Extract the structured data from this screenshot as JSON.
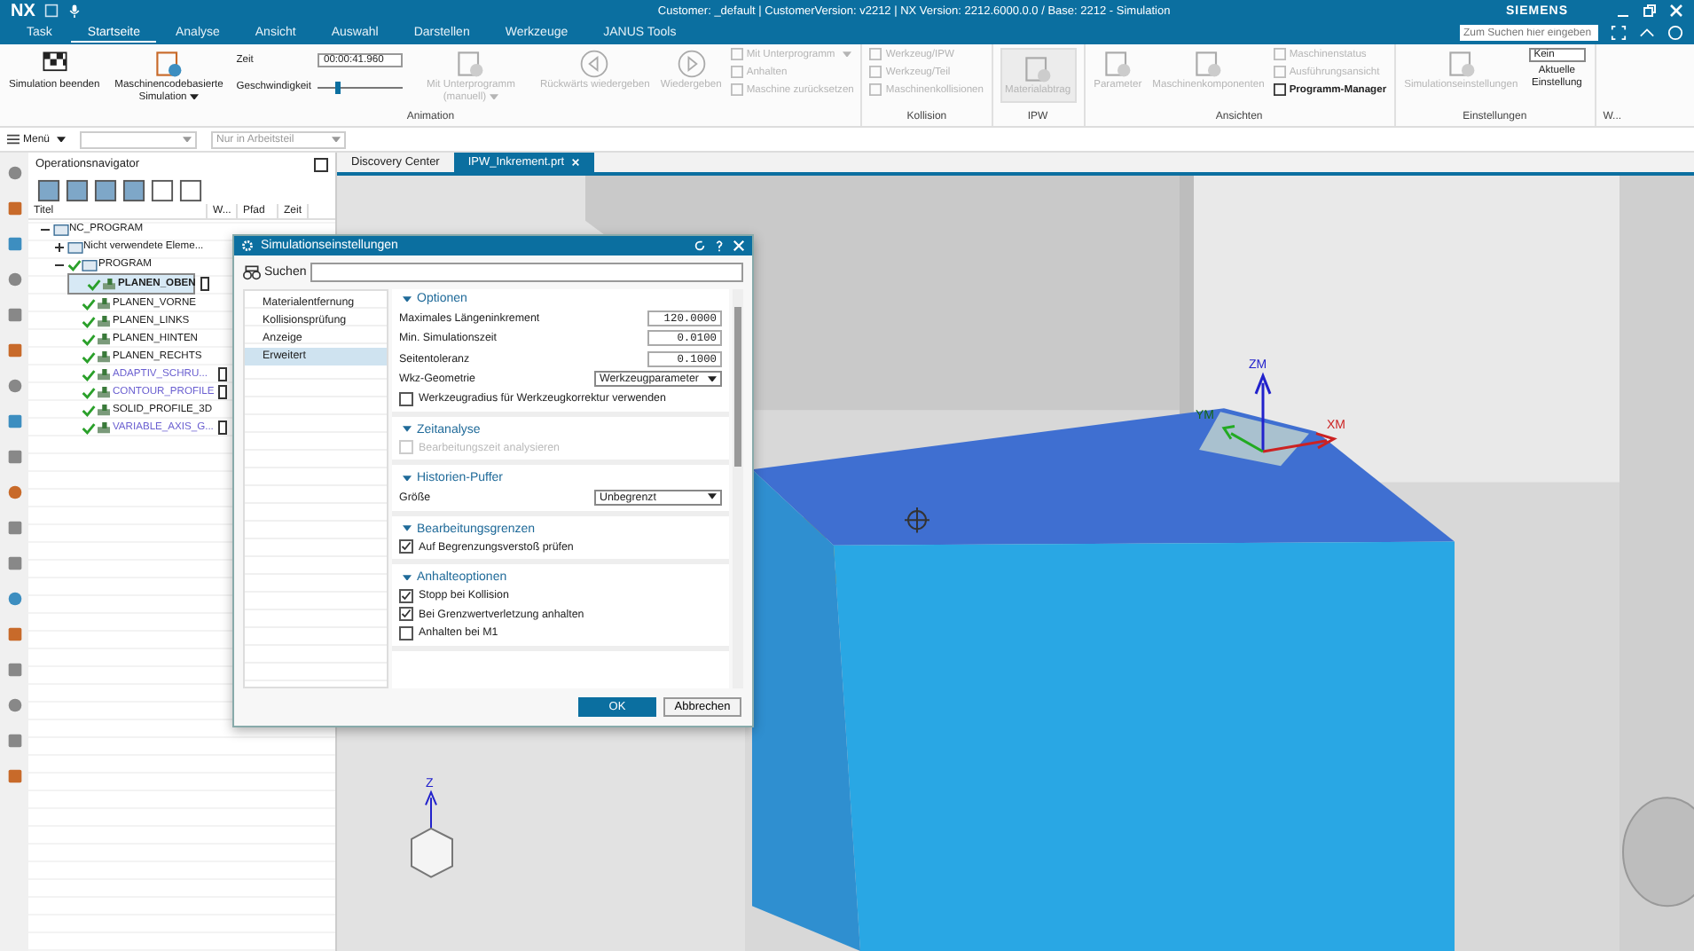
{
  "app": {
    "name": "NX",
    "title": "Customer: _default | CustomerVersion: v2212 | NX Version: 2212.6000.0.0 / Base: 2212 - Simulation",
    "brand": "SIEMENS",
    "search_placeholder": "Zum Suchen hier eingeben"
  },
  "tabs": [
    {
      "label": "Task",
      "selected": false
    },
    {
      "label": "Startseite",
      "selected": true
    },
    {
      "label": "Analyse",
      "selected": false
    },
    {
      "label": "Ansicht",
      "selected": false
    },
    {
      "label": "Auswahl",
      "selected": false
    },
    {
      "label": "Darstellen",
      "selected": false
    },
    {
      "label": "Werkzeuge",
      "selected": false
    },
    {
      "label": "JANUS Tools",
      "selected": false
    }
  ],
  "ribbon": [
    {
      "label": "Animation",
      "items": [
        {
          "kind": "big",
          "label": "Simulation beenden",
          "disabled": false,
          "dropdown": false
        },
        {
          "kind": "big",
          "label": "Maschinencodebasierte Simulation",
          "disabled": false,
          "dropdown": true
        },
        {
          "kind": "timer",
          "time_label": "Zeit",
          "time": "00:00:41.960",
          "speed_label": "Geschwindigkeit",
          "level": 0.25
        },
        {
          "kind": "big",
          "label": "Mit Unterprogramm (manuell)",
          "disabled": true,
          "dropdown": true
        },
        {
          "kind": "big",
          "label": "Rückwärts wiedergeben",
          "disabled": true,
          "dropdown": false
        },
        {
          "kind": "big",
          "label": "Wiedergeben",
          "disabled": true,
          "dropdown": false
        },
        {
          "kind": "stack",
          "entries": [
            {
              "label": "Mit Unterprogramm",
              "disabled": true,
              "dropdown": true
            },
            {
              "label": "Anhalten",
              "disabled": true,
              "dropdown": false
            },
            {
              "label": "Maschine zurücksetzen",
              "disabled": true,
              "dropdown": false
            }
          ]
        }
      ]
    },
    {
      "label": "Kollision",
      "items": [
        {
          "kind": "stack",
          "entries": [
            {
              "label": "Werkzeug/IPW",
              "disabled": true,
              "dropdown": false
            },
            {
              "label": "Werkzeug/Teil",
              "disabled": true,
              "dropdown": false
            },
            {
              "label": "Maschinenkollisionen",
              "disabled": true,
              "dropdown": false
            }
          ]
        }
      ]
    },
    {
      "label": "IPW",
      "items": [
        {
          "kind": "big",
          "label": "Materialabtrag",
          "disabled": true,
          "dropdown": false
        }
      ]
    },
    {
      "label": "Ansichten",
      "items": [
        {
          "kind": "big",
          "label": "Parameter",
          "disabled": true,
          "dropdown": false
        },
        {
          "kind": "big",
          "label": "Maschinenkomponenten",
          "disabled": true,
          "dropdown": false
        },
        {
          "kind": "stack",
          "entries": [
            {
              "label": "Maschinenstatus",
              "disabled": true,
              "dropdown": false
            },
            {
              "label": "Ausführungsansicht",
              "disabled": true,
              "dropdown": false
            },
            {
              "label": "Programm-Manager",
              "disabled": false,
              "dropdown": false
            }
          ]
        }
      ]
    },
    {
      "label": "Einstellungen",
      "items": [
        {
          "kind": "big",
          "label": "Simulationseinstellungen",
          "disabled": true,
          "dropdown": false
        },
        {
          "kind": "field",
          "value": "Kein",
          "label": "Aktuelle Einstellung"
        }
      ]
    },
    {
      "label": "W..."
    }
  ],
  "toolbar": {
    "menu": "Menü",
    "filter": "Nur in Arbeitsteil"
  },
  "navigator": {
    "title": "Operationsnavigator",
    "columns": [
      "Titel",
      "W...",
      "Pfad",
      "Zeit"
    ],
    "tree": [
      {
        "label": "NC_PROGRAM",
        "kind": "group",
        "expanded": true,
        "children": [
          {
            "label": "Nicht verwendete Eleme...",
            "kind": "group",
            "expanded": false
          },
          {
            "label": "PROGRAM",
            "kind": "group",
            "expanded": true,
            "done": true,
            "children": [
              {
                "label": "PLANEN_OBEN",
                "kind": "operation",
                "done": true,
                "selected": true,
                "color": "#1a1a1a",
                "flag": true
              },
              {
                "label": "PLANEN_VORNE",
                "kind": "operation",
                "done": true,
                "selected": false,
                "color": "#1a1a1a",
                "flag": false
              },
              {
                "label": "PLANEN_LINKS",
                "kind": "operation",
                "done": true,
                "selected": false,
                "color": "#1a1a1a",
                "flag": false
              },
              {
                "label": "PLANEN_HINTEN",
                "kind": "operation",
                "done": true,
                "selected": false,
                "color": "#1a1a1a",
                "flag": false
              },
              {
                "label": "PLANEN_RECHTS",
                "kind": "operation",
                "done": true,
                "selected": false,
                "color": "#1a1a1a",
                "flag": false
              },
              {
                "label": "ADAPTIV_SCHRU...",
                "kind": "operation",
                "done": true,
                "selected": false,
                "color": "#6a5fd0",
                "flag": true
              },
              {
                "label": "CONTOUR_PROFILE",
                "kind": "operation",
                "done": true,
                "selected": false,
                "color": "#6a5fd0",
                "flag": true
              },
              {
                "label": "SOLID_PROFILE_3D",
                "kind": "operation",
                "done": true,
                "selected": false,
                "color": "#1a1a1a",
                "flag": false
              },
              {
                "label": "VARIABLE_AXIS_G...",
                "kind": "operation",
                "done": true,
                "selected": false,
                "color": "#6a5fd0",
                "flag": true
              }
            ]
          }
        ]
      }
    ]
  },
  "viewport": {
    "tabs": [
      {
        "label": "Discovery Center",
        "selected": false,
        "closable": false
      },
      {
        "label": "IPW_Inkrement.prt",
        "selected": true,
        "closable": true
      }
    ],
    "csys_labels": [
      "ZM",
      "YM",
      "XM"
    ],
    "triad_label": "Z"
  },
  "dialog": {
    "title": "Simulationseinstellungen",
    "search_label": "Suchen",
    "categories": [
      {
        "label": "Materialentfernung",
        "selected": false
      },
      {
        "label": "Kollisionsprüfung",
        "selected": false
      },
      {
        "label": "Anzeige",
        "selected": false
      },
      {
        "label": "Erweitert",
        "selected": true
      }
    ],
    "sections": [
      {
        "title": "Optionen",
        "rows": [
          {
            "kind": "number",
            "label": "Maximales Längeninkrement",
            "value": "120.0000"
          },
          {
            "kind": "number",
            "label": "Min. Simulationszeit",
            "value": "0.0100"
          },
          {
            "kind": "number",
            "label": "Seitentoleranz",
            "value": "0.1000"
          },
          {
            "kind": "select",
            "label": "Wkz-Geometrie",
            "value": "Werkzeugparameter"
          },
          {
            "kind": "checkbox",
            "label": "Werkzeugradius für Werkzeugkorrektur verwenden",
            "checked": false,
            "disabled": false
          }
        ]
      },
      {
        "title": "Zeitanalyse",
        "rows": [
          {
            "kind": "checkbox",
            "label": "Bearbeitungszeit analysieren",
            "checked": false,
            "disabled": true
          }
        ]
      },
      {
        "title": "Historien-Puffer",
        "rows": [
          {
            "kind": "select",
            "label": "Größe",
            "value": "Unbegrenzt"
          }
        ]
      },
      {
        "title": "Bearbeitungsgrenzen",
        "rows": [
          {
            "kind": "checkbox",
            "label": "Auf Begrenzungsverstoß prüfen",
            "checked": true,
            "disabled": false
          }
        ]
      },
      {
        "title": "Anhalteoptionen",
        "rows": [
          {
            "kind": "checkbox",
            "label": "Stopp bei Kollision",
            "checked": true,
            "disabled": false
          },
          {
            "kind": "checkbox",
            "label": "Bei Grenzwertverletzung anhalten",
            "checked": true,
            "disabled": false
          },
          {
            "kind": "checkbox",
            "label": "Anhalten bei M1",
            "checked": false,
            "disabled": false
          }
        ]
      }
    ],
    "buttons": [
      {
        "label": "OK",
        "primary": true
      },
      {
        "label": "Abbrechen",
        "primary": false
      }
    ]
  }
}
